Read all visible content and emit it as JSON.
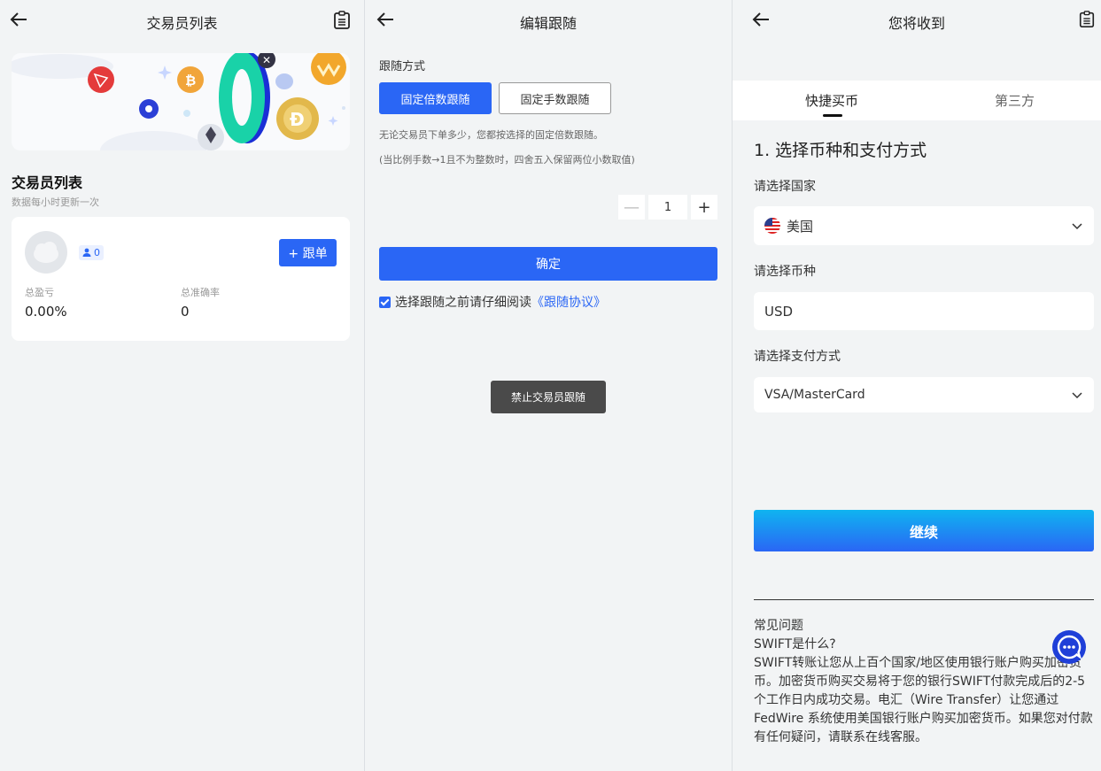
{
  "panel1": {
    "title": "交易员列表",
    "section_title": "交易员列表",
    "section_subtitle": "数据每小时更新一次",
    "card": {
      "follower_count": "0",
      "follow_button": "+ 跟单",
      "stats": [
        {
          "label": "总盈亏",
          "value": "0.00%"
        },
        {
          "label": "总准确率",
          "value": "0"
        }
      ]
    },
    "banner_digit": "0"
  },
  "panel2": {
    "title": "编辑跟随",
    "follow_mode_label": "跟随方式",
    "mode_options": [
      "固定倍数跟随",
      "固定手数跟随"
    ],
    "selected_mode": "固定倍数跟随",
    "note1": "无论交易员下单多少，您都按选择的固定倍数跟随。",
    "note2": "(当比例手数→1且不为整数时，四舍五入保留两位小数取值)",
    "stepper": {
      "minus": "—",
      "value": "1",
      "plus": "+"
    },
    "confirm_button": "确定",
    "agreement_text": "选择跟随之前请仔细阅读",
    "agreement_link": "《跟随协议》",
    "stop_button": "禁止交易员跟随"
  },
  "panel3": {
    "title": "您将收到",
    "tabs": [
      "快捷买币",
      "第三方"
    ],
    "active_tab": "快捷买币",
    "step_title": "1. 选择币种和支付方式",
    "country_label": "请选择国家",
    "country_value": "美国",
    "currency_label": "请选择币种",
    "currency_value": "USD",
    "payment_label": "请选择支付方式",
    "payment_value": "VSA/MasterCard",
    "continue_button": "继续",
    "faq_title": "常见问题",
    "faq_question": "SWIFT是什么?",
    "faq_answer": "SWIFT转账让您从上百个国家/地区使用银行账户购买加密货币。加密货币购买交易将于您的银行SWIFT付款完成后的2-5个工作日内成功交易。电汇（Wire Transfer）让您通过FedWire 系统使用美国银行账户购买加密货币。如果您对付款有任何疑问，请联系在线客服。"
  },
  "colors": {
    "primary": "#2a66f5",
    "background": "#f2f4f5",
    "dark_button": "#4a4a4a",
    "gradient_top": "#0fb4f0"
  }
}
